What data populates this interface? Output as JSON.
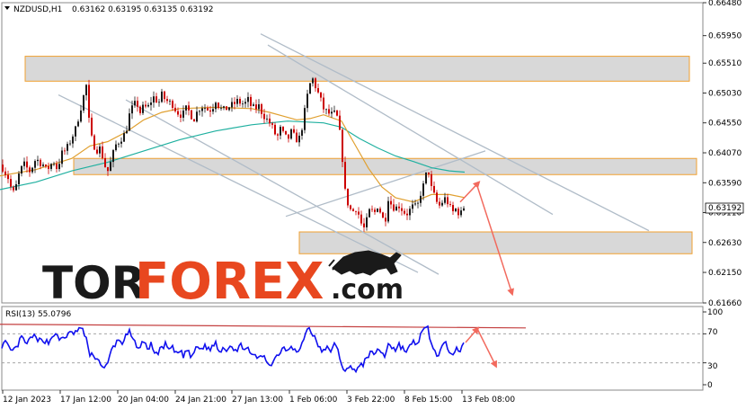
{
  "header": {
    "symbol_text": "NZDUSD,H1",
    "ohlc_text": "0.63162 0.63195 0.63135 0.63192"
  },
  "rsi_panel": {
    "label": "RSI(13) 55.0796",
    "levels": [
      "100",
      "70",
      "30",
      "0"
    ]
  },
  "watermark": {
    "part1": "TOR",
    "part2": "FOREX",
    "part3": ".com"
  },
  "current_price_label": "0.63192",
  "colors": {
    "bull": "#1a1a1a",
    "bear": "#cc0000",
    "ma_fast": "#e0a030",
    "ma_slow": "#20b0a0",
    "rsi": "#1010ee",
    "trend": "#b0bcc8",
    "zone_fill": "#d8d8d8",
    "zone_border": "#f0a030",
    "arrow": "#f26a5e",
    "rsi_trend": "#c44040"
  },
  "chart_data": {
    "type": "candlestick",
    "title": "NZDUSD,H1",
    "y_ticks": [
      "0.66480",
      "0.65950",
      "0.65510",
      "0.65030",
      "0.64550",
      "0.64070",
      "0.63590",
      "0.63110",
      "0.62630",
      "0.62150",
      "0.61660"
    ],
    "x_ticks": [
      "12 Jan 2023",
      "17 Jan 12:00",
      "20 Jan 04:00",
      "24 Jan 21:00",
      "27 Jan 13:00",
      "1 Feb 06:00",
      "3 Feb 22:00",
      "8 Feb 15:00",
      "13 Feb 08:00"
    ],
    "ylim": [
      0.6166,
      0.6648
    ],
    "price_path": [
      [
        0,
        0.6398
      ],
      [
        4,
        0.6378
      ],
      [
        8,
        0.6372
      ],
      [
        12,
        0.6352
      ],
      [
        16,
        0.634
      ],
      [
        20,
        0.6368
      ],
      [
        24,
        0.6382
      ],
      [
        28,
        0.639
      ],
      [
        32,
        0.6375
      ],
      [
        36,
        0.6385
      ],
      [
        40,
        0.6398
      ],
      [
        44,
        0.6392
      ],
      [
        48,
        0.6388
      ],
      [
        52,
        0.6378
      ],
      [
        56,
        0.6388
      ],
      [
        60,
        0.6392
      ],
      [
        64,
        0.638
      ],
      [
        68,
        0.6405
      ],
      [
        72,
        0.641
      ],
      [
        76,
        0.6418
      ],
      [
        80,
        0.6432
      ],
      [
        84,
        0.6445
      ],
      [
        88,
        0.6468
      ],
      [
        92,
        0.6492
      ],
      [
        96,
        0.6515
      ],
      [
        100,
        0.644
      ],
      [
        104,
        0.642
      ],
      [
        108,
        0.6412
      ],
      [
        112,
        0.6415
      ],
      [
        116,
        0.6388
      ],
      [
        120,
        0.6378
      ],
      [
        124,
        0.6395
      ],
      [
        128,
        0.6418
      ],
      [
        132,
        0.6425
      ],
      [
        136,
        0.6432
      ],
      [
        140,
        0.644
      ],
      [
        144,
        0.6468
      ],
      [
        148,
        0.6482
      ],
      [
        152,
        0.6488
      ],
      [
        156,
        0.6472
      ],
      [
        160,
        0.6482
      ],
      [
        164,
        0.6478
      ],
      [
        168,
        0.649
      ],
      [
        172,
        0.6498
      ],
      [
        176,
        0.6485
      ],
      [
        180,
        0.65
      ],
      [
        184,
        0.6492
      ],
      [
        188,
        0.6488
      ],
      [
        192,
        0.6485
      ],
      [
        196,
        0.6475
      ],
      [
        200,
        0.6468
      ],
      [
        204,
        0.647
      ],
      [
        208,
        0.648
      ],
      [
        212,
        0.6468
      ],
      [
        216,
        0.6462
      ],
      [
        220,
        0.6475
      ],
      [
        224,
        0.6482
      ],
      [
        228,
        0.648
      ],
      [
        232,
        0.6475
      ],
      [
        236,
        0.6478
      ],
      [
        240,
        0.6492
      ],
      [
        244,
        0.648
      ],
      [
        248,
        0.6475
      ],
      [
        252,
        0.6478
      ],
      [
        256,
        0.6482
      ],
      [
        260,
        0.6485
      ],
      [
        264,
        0.649
      ],
      [
        268,
        0.6487
      ],
      [
        272,
        0.6485
      ],
      [
        276,
        0.6492
      ],
      [
        280,
        0.648
      ],
      [
        284,
        0.6478
      ],
      [
        288,
        0.6482
      ],
      [
        292,
        0.647
      ],
      [
        296,
        0.6462
      ],
      [
        300,
        0.6455
      ],
      [
        304,
        0.6445
      ],
      [
        308,
        0.643
      ],
      [
        312,
        0.6445
      ],
      [
        316,
        0.6435
      ],
      [
        320,
        0.6428
      ],
      [
        324,
        0.644
      ],
      [
        328,
        0.6432
      ],
      [
        332,
        0.6425
      ],
      [
        336,
        0.6448
      ],
      [
        340,
        0.6482
      ],
      [
        344,
        0.6515
      ],
      [
        348,
        0.6525
      ],
      [
        352,
        0.651
      ],
      [
        356,
        0.6495
      ],
      [
        360,
        0.6478
      ],
      [
        364,
        0.6472
      ],
      [
        368,
        0.6468
      ],
      [
        372,
        0.647
      ],
      [
        376,
        0.6462
      ],
      [
        380,
        0.6415
      ],
      [
        384,
        0.6345
      ],
      [
        388,
        0.632
      ],
      [
        392,
        0.6312
      ],
      [
        396,
        0.6318
      ],
      [
        400,
        0.6305
      ],
      [
        404,
        0.6282
      ],
      [
        408,
        0.6298
      ],
      [
        412,
        0.6318
      ],
      [
        416,
        0.6308
      ],
      [
        420,
        0.6322
      ],
      [
        424,
        0.631
      ],
      [
        428,
        0.6292
      ],
      [
        432,
        0.6335
      ],
      [
        436,
        0.6322
      ],
      [
        440,
        0.6318
      ],
      [
        444,
        0.6322
      ],
      [
        448,
        0.6315
      ],
      [
        452,
        0.6308
      ],
      [
        456,
        0.6315
      ],
      [
        460,
        0.6322
      ],
      [
        464,
        0.6318
      ],
      [
        468,
        0.6342
      ],
      [
        472,
        0.6358
      ],
      [
        476,
        0.6385
      ],
      [
        480,
        0.635
      ],
      [
        484,
        0.6335
      ],
      [
        488,
        0.632
      ],
      [
        492,
        0.6328
      ],
      [
        496,
        0.6335
      ],
      [
        500,
        0.632
      ],
      [
        504,
        0.6312
      ],
      [
        508,
        0.6318
      ],
      [
        512,
        0.6305
      ],
      [
        515,
        0.632
      ],
      [
        518,
        0.6319
      ]
    ],
    "ma_fast": [
      [
        0,
        0.637
      ],
      [
        40,
        0.638
      ],
      [
        80,
        0.6398
      ],
      [
        100,
        0.6418
      ],
      [
        120,
        0.6425
      ],
      [
        140,
        0.644
      ],
      [
        160,
        0.646
      ],
      [
        180,
        0.6472
      ],
      [
        200,
        0.6478
      ],
      [
        240,
        0.648
      ],
      [
        280,
        0.6478
      ],
      [
        300,
        0.6472
      ],
      [
        330,
        0.646
      ],
      [
        345,
        0.6462
      ],
      [
        360,
        0.6468
      ],
      [
        380,
        0.6458
      ],
      [
        395,
        0.642
      ],
      [
        410,
        0.6382
      ],
      [
        425,
        0.6352
      ],
      [
        440,
        0.6335
      ],
      [
        460,
        0.6328
      ],
      [
        480,
        0.634
      ],
      [
        500,
        0.634
      ],
      [
        517,
        0.6335
      ]
    ],
    "ma_slow": [
      [
        0,
        0.6348
      ],
      [
        40,
        0.636
      ],
      [
        80,
        0.6378
      ],
      [
        120,
        0.6392
      ],
      [
        160,
        0.641
      ],
      [
        200,
        0.6428
      ],
      [
        240,
        0.6442
      ],
      [
        280,
        0.6452
      ],
      [
        320,
        0.6458
      ],
      [
        360,
        0.6455
      ],
      [
        380,
        0.6448
      ],
      [
        400,
        0.643
      ],
      [
        420,
        0.6415
      ],
      [
        440,
        0.6402
      ],
      [
        460,
        0.6393
      ],
      [
        480,
        0.6383
      ],
      [
        500,
        0.6378
      ],
      [
        517,
        0.6376
      ]
    ],
    "zones": [
      {
        "x1": 28,
        "x2": 767,
        "y1": 0.6562,
        "y2": 0.6522
      },
      {
        "x1": 82,
        "x2": 775,
        "y1": 0.6398,
        "y2": 0.6372
      },
      {
        "x1": 333,
        "x2": 770,
        "y1": 0.628,
        "y2": 0.6245
      }
    ],
    "trend_lines": [
      {
        "x1": 290,
        "y1": 0.6598,
        "x2": 722,
        "y2": 0.6282
      },
      {
        "x1": 298,
        "y1": 0.658,
        "x2": 615,
        "y2": 0.6308
      },
      {
        "x1": 65,
        "y1": 0.65,
        "x2": 465,
        "y2": 0.6215
      },
      {
        "x1": 140,
        "y1": 0.6492,
        "x2": 488,
        "y2": 0.6212
      },
      {
        "x1": 318,
        "y1": 0.6305,
        "x2": 540,
        "y2": 0.641
      }
    ],
    "forecast_arrows": [
      {
        "x1": 512,
        "y1": 0.6328,
        "x2": 533,
        "y2": 0.636
      },
      {
        "x1": 530,
        "y1": 0.6358,
        "x2": 570,
        "y2": 0.618
      }
    ],
    "rsi": {
      "ylim": [
        0,
        100
      ],
      "levels": [
        70,
        30
      ],
      "path": [
        [
          0,
          52
        ],
        [
          6,
          58
        ],
        [
          12,
          45
        ],
        [
          18,
          50
        ],
        [
          24,
          65
        ],
        [
          30,
          55
        ],
        [
          36,
          68
        ],
        [
          42,
          60
        ],
        [
          48,
          62
        ],
        [
          54,
          58
        ],
        [
          60,
          70
        ],
        [
          66,
          62
        ],
        [
          72,
          66
        ],
        [
          78,
          70
        ],
        [
          84,
          72
        ],
        [
          90,
          78
        ],
        [
          96,
          65
        ],
        [
          100,
          38
        ],
        [
          104,
          42
        ],
        [
          108,
          35
        ],
        [
          112,
          30
        ],
        [
          116,
          22
        ],
        [
          120,
          28
        ],
        [
          124,
          48
        ],
        [
          128,
          55
        ],
        [
          132,
          62
        ],
        [
          136,
          58
        ],
        [
          140,
          66
        ],
        [
          144,
          72
        ],
        [
          148,
          60
        ],
        [
          152,
          55
        ],
        [
          156,
          50
        ],
        [
          160,
          62
        ],
        [
          164,
          48
        ],
        [
          168,
          55
        ],
        [
          172,
          46
        ],
        [
          176,
          42
        ],
        [
          180,
          52
        ],
        [
          184,
          55
        ],
        [
          188,
          48
        ],
        [
          192,
          50
        ],
        [
          196,
          42
        ],
        [
          200,
          46
        ],
        [
          204,
          40
        ],
        [
          208,
          48
        ],
        [
          212,
          38
        ],
        [
          216,
          45
        ],
        [
          220,
          52
        ],
        [
          224,
          48
        ],
        [
          228,
          55
        ],
        [
          232,
          48
        ],
        [
          236,
          52
        ],
        [
          240,
          58
        ],
        [
          244,
          45
        ],
        [
          248,
          52
        ],
        [
          252,
          48
        ],
        [
          256,
          56
        ],
        [
          260,
          50
        ],
        [
          264,
          46
        ],
        [
          268,
          54
        ],
        [
          272,
          52
        ],
        [
          276,
          48
        ],
        [
          280,
          38
        ],
        [
          284,
          42
        ],
        [
          288,
          35
        ],
        [
          292,
          40
        ],
        [
          296,
          34
        ],
        [
          300,
          28
        ],
        [
          304,
          32
        ],
        [
          308,
          40
        ],
        [
          312,
          46
        ],
        [
          316,
          52
        ],
        [
          320,
          48
        ],
        [
          324,
          55
        ],
        [
          328,
          48
        ],
        [
          332,
          44
        ],
        [
          336,
          55
        ],
        [
          340,
          72
        ],
        [
          344,
          78
        ],
        [
          348,
          70
        ],
        [
          352,
          58
        ],
        [
          356,
          50
        ],
        [
          360,
          45
        ],
        [
          364,
          50
        ],
        [
          368,
          48
        ],
        [
          372,
          55
        ],
        [
          376,
          46
        ],
        [
          380,
          30
        ],
        [
          384,
          18
        ],
        [
          388,
          22
        ],
        [
          392,
          25
        ],
        [
          396,
          20
        ],
        [
          400,
          24
        ],
        [
          404,
          28
        ],
        [
          408,
          38
        ],
        [
          412,
          44
        ],
        [
          416,
          40
        ],
        [
          420,
          50
        ],
        [
          424,
          45
        ],
        [
          428,
          38
        ],
        [
          432,
          58
        ],
        [
          436,
          52
        ],
        [
          440,
          48
        ],
        [
          444,
          55
        ],
        [
          448,
          50
        ],
        [
          452,
          46
        ],
        [
          456,
          52
        ],
        [
          460,
          58
        ],
        [
          464,
          56
        ],
        [
          468,
          68
        ],
        [
          472,
          75
        ],
        [
          476,
          78
        ],
        [
          480,
          55
        ],
        [
          484,
          45
        ],
        [
          488,
          40
        ],
        [
          492,
          52
        ],
        [
          496,
          55
        ],
        [
          500,
          48
        ],
        [
          504,
          45
        ],
        [
          508,
          52
        ],
        [
          512,
          46
        ],
        [
          516,
          55
        ]
      ],
      "trend_line": {
        "x1": 0,
        "y1": 83,
        "x2": 585,
        "y2": 78
      },
      "forecast_arrows": [
        {
          "x1": 518,
          "y1": 58,
          "x2": 532,
          "y2": 78
        },
        {
          "x1": 531,
          "y1": 77,
          "x2": 552,
          "y2": 25
        }
      ]
    }
  }
}
